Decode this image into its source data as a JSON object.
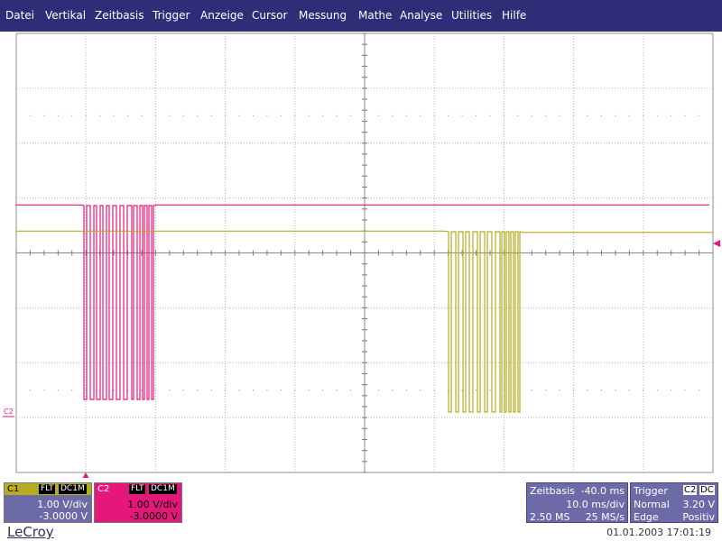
{
  "menu": [
    "Datei",
    "Vertikal",
    "Zeitbasis",
    "Trigger",
    "Anzeige",
    "Cursor",
    "Messung",
    "Mathe",
    "Analyse",
    "Utilities",
    "Hilfe"
  ],
  "colors": {
    "menubar": "#2f2c78",
    "ch1": "#b5ad1f",
    "ch2": "#e5177b",
    "grid": "#9b9b9b",
    "panel": "#6d6aa8"
  },
  "scope": {
    "ch2_marker_label": "C2"
  },
  "c1": {
    "name": "C1",
    "tag1": "FLT",
    "tag2": "DC1M",
    "scale": "1.00 V/div",
    "offset": "-3.0000 V"
  },
  "c2": {
    "name": "C2",
    "tag1": "FLT",
    "tag2": "DC1M",
    "scale": "1.00 V/div",
    "offset": "-3.0000 V"
  },
  "timebase": {
    "label": "Zeitbasis",
    "delay": "-40.0 ms",
    "per_div": "10.0 ms/div",
    "samples": "2.50 MS",
    "rate": "25 MS/s"
  },
  "trigger": {
    "label": "Trigger",
    "channel": "C2",
    "coupling": "DC",
    "mode": "Normal",
    "level": "3.20 V",
    "type": "Edge",
    "slope": "Positiv"
  },
  "brand": "LeCroy",
  "datetime": "01.01.2003 17:01:19"
}
